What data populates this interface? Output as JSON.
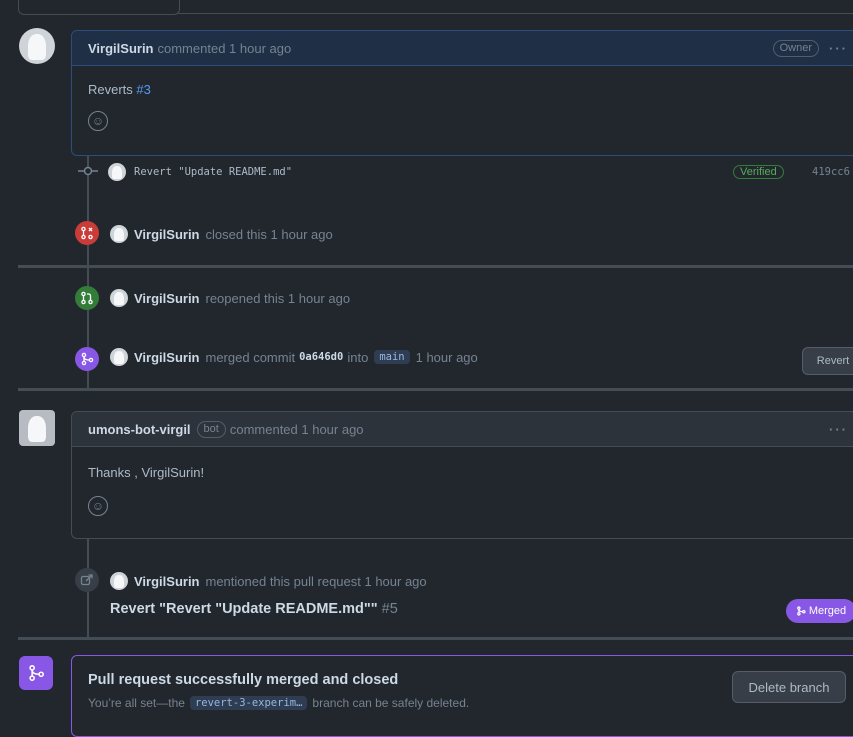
{
  "comment1": {
    "author": "VirgilSurin",
    "meta": "commented 1 hour ago",
    "role_badge": "Owner",
    "more": "···",
    "body_prefix": "Reverts",
    "body_link": "#3",
    "reaction_icon": "smiley-icon"
  },
  "commit_event": {
    "message": "Revert \"Update README.md\"",
    "verified": "Verified",
    "sha": "419cc6"
  },
  "closed_event": {
    "author": "VirgilSurin",
    "text": "closed this 1 hour ago"
  },
  "reopened_event": {
    "author": "VirgilSurin",
    "text": "reopened this 1 hour ago"
  },
  "merged_event": {
    "author": "VirgilSurin",
    "text_before": "merged commit",
    "commit": "0a646d0",
    "into": "into",
    "branch": "main",
    "time": "1 hour ago",
    "revert_button": "Revert"
  },
  "comment2": {
    "author": "umons-bot-virgil",
    "bot_badge": "bot",
    "meta": "commented 1 hour ago",
    "more": "···",
    "body": "Thanks , VirgilSurin!",
    "reaction_icon": "smiley-icon"
  },
  "mention_event": {
    "author": "VirgilSurin",
    "text": "mentioned this pull request 1 hour ago",
    "pr_title": "Revert \"Revert \"Update README.md\"\"",
    "pr_number": "#5",
    "status": "Merged"
  },
  "merge_box": {
    "title": "Pull request successfully merged and closed",
    "desc_before": "You’re all set—the",
    "branch": "revert-3-experim…",
    "desc_after": "branch can be safely deleted.",
    "delete_button": "Delete branch"
  },
  "colors": {
    "background": "#22272e",
    "closed": "#c93c37",
    "open": "#347d39",
    "merged": "#8957e5",
    "link": "#539bf5"
  }
}
